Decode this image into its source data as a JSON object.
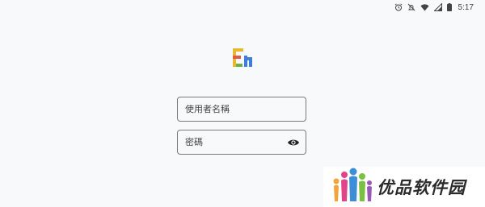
{
  "status_bar": {
    "time": "5:17",
    "icons": [
      "alarm-icon",
      "mute-icon",
      "wifi-icon",
      "signal-icon",
      "battery-icon"
    ]
  },
  "logo": {
    "icon": "app-logo-icon"
  },
  "login_form": {
    "username": {
      "placeholder": "使用者名稱",
      "value": ""
    },
    "password": {
      "placeholder": "密碼",
      "value": "",
      "toggle_icon": "eye-icon"
    }
  },
  "watermark": {
    "text": "优品软件园"
  }
}
